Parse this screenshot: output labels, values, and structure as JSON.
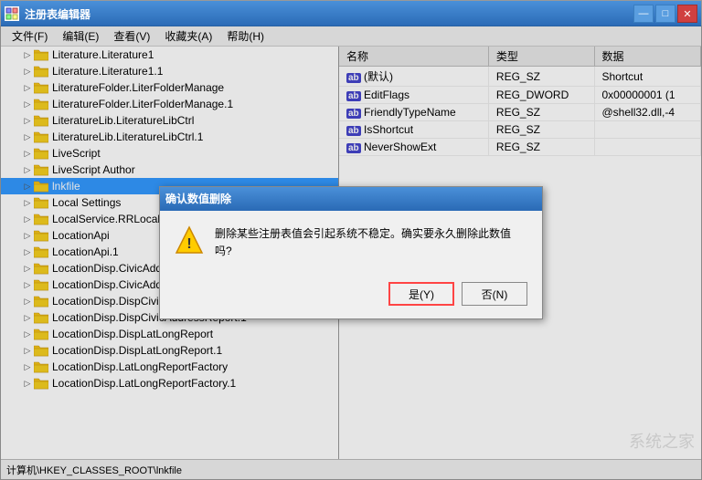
{
  "window": {
    "title": "注册表编辑器",
    "titleIcon": "regedit"
  },
  "menu": {
    "items": [
      {
        "label": "文件(F)",
        "key": "file"
      },
      {
        "label": "编辑(E)",
        "key": "edit"
      },
      {
        "label": "查看(V)",
        "key": "view"
      },
      {
        "label": "收藏夹(A)",
        "key": "favorites"
      },
      {
        "label": "帮助(H)",
        "key": "help"
      }
    ]
  },
  "tree": {
    "items": [
      {
        "label": "Literature.Literature1",
        "indent": 1,
        "expanded": false
      },
      {
        "label": "Literature.Literature1.1",
        "indent": 1,
        "expanded": false
      },
      {
        "label": "LiteratureFolder.LiterFolderManage",
        "indent": 1,
        "expanded": false
      },
      {
        "label": "LiteratureFolder.LiterFolderManage.1",
        "indent": 1,
        "expanded": false
      },
      {
        "label": "LiteratureLib.LiteratureLibCtrl",
        "indent": 1,
        "expanded": false
      },
      {
        "label": "LiteratureLib.LiteratureLibCtrl.1",
        "indent": 1,
        "expanded": false
      },
      {
        "label": "LiveScript",
        "indent": 1,
        "expanded": false
      },
      {
        "label": "LiveScript Author",
        "indent": 1,
        "expanded": false
      },
      {
        "label": "lnkfile",
        "indent": 1,
        "expanded": false,
        "selected": true
      },
      {
        "label": "Local Settings",
        "indent": 1,
        "expanded": false
      },
      {
        "label": "LocalService.RRLocalService...",
        "indent": 1,
        "expanded": false
      },
      {
        "label": "LocationApi",
        "indent": 1,
        "expanded": false
      },
      {
        "label": "LocationApi.1",
        "indent": 1,
        "expanded": false
      },
      {
        "label": "LocationDisp.CivicAddressR...",
        "indent": 1,
        "expanded": false
      },
      {
        "label": "LocationDisp.CivicAddressReportFactory.1",
        "indent": 1,
        "expanded": false
      },
      {
        "label": "LocationDisp.DispCivicAddressReport",
        "indent": 1,
        "expanded": false
      },
      {
        "label": "LocationDisp.DispCivicAddressReport.1",
        "indent": 1,
        "expanded": false
      },
      {
        "label": "LocationDisp.DispLatLongReport",
        "indent": 1,
        "expanded": false
      },
      {
        "label": "LocationDisp.DispLatLongReport.1",
        "indent": 1,
        "expanded": false
      },
      {
        "label": "LocationDisp.LatLongReportFactory",
        "indent": 1,
        "expanded": false
      },
      {
        "label": "LocationDisp.LatLongReportFactory.1",
        "indent": 1,
        "expanded": false
      }
    ]
  },
  "registry": {
    "columns": [
      "名称",
      "类型",
      "数据"
    ],
    "rows": [
      {
        "name": "(默认)",
        "type": "REG_SZ",
        "data": "Shortcut",
        "icon": "ab"
      },
      {
        "name": "EditFlags",
        "type": "REG_DWORD",
        "data": "0x00000001 (1",
        "icon": "ab"
      },
      {
        "name": "FriendlyTypeName",
        "type": "REG_SZ",
        "data": "@shell32.dll,-4",
        "icon": "ab"
      },
      {
        "name": "IsShortcut",
        "type": "REG_SZ",
        "data": "",
        "icon": "ab"
      },
      {
        "name": "NeverShowExt",
        "type": "REG_SZ",
        "data": "",
        "icon": "ab"
      }
    ]
  },
  "dialog": {
    "title": "确认数值删除",
    "message": "删除某些注册表值会引起系统不稳定。确实要永久删除此数值吗?",
    "yes_label": "是(Y)",
    "no_label": "否(N)"
  },
  "statusBar": {
    "path": "计算机\\HKEY_CLASSES_ROOT\\lnkfile"
  },
  "titleButtons": {
    "minimize": "—",
    "restore": "□",
    "close": "✕"
  }
}
